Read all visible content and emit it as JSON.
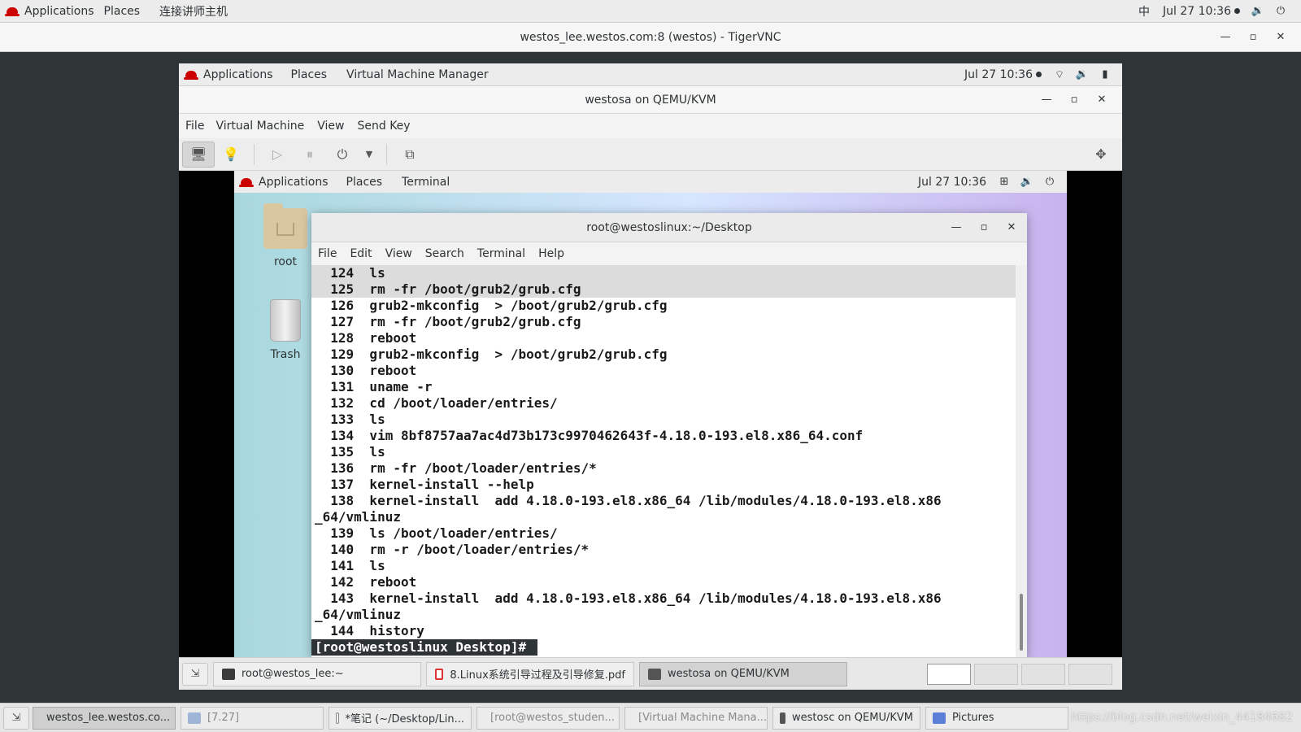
{
  "host_topbar": {
    "applications": "Applications",
    "places": "Places",
    "custom_app": "连接讲师主机",
    "ime": "中",
    "datetime": "Jul 27  10:36"
  },
  "vnc_window": {
    "title": "westos_lee.westos.com:8 (westos) - TigerVNC"
  },
  "remote_topbar": {
    "applications": "Applications",
    "places": "Places",
    "vmm": "Virtual Machine Manager",
    "datetime": "Jul 27  10:36"
  },
  "vm_window": {
    "title": "westosa on QEMU/KVM",
    "menu": [
      "File",
      "Virtual Machine",
      "View",
      "Send Key"
    ]
  },
  "guest_topbar": {
    "applications": "Applications",
    "places": "Places",
    "terminal": "Terminal",
    "datetime": "Jul 27  10:36"
  },
  "desktop_icons": {
    "home": "root",
    "trash": "Trash"
  },
  "terminal": {
    "title": "root@westoslinux:~/Desktop",
    "menu": [
      "File",
      "Edit",
      "View",
      "Search",
      "Terminal",
      "Help"
    ],
    "lines": [
      "  124  ls",
      "  125  rm -fr /boot/grub2/grub.cfg",
      "  126  grub2-mkconfig  > /boot/grub2/grub.cfg",
      "  127  rm -fr /boot/grub2/grub.cfg",
      "  128  reboot",
      "  129  grub2-mkconfig  > /boot/grub2/grub.cfg",
      "  130  reboot",
      "  131  uname -r",
      "  132  cd /boot/loader/entries/",
      "  133  ls",
      "  134  vim 8bf8757aa7ac4d73b173c9970462643f-4.18.0-193.el8.x86_64.conf",
      "  135  ls",
      "  136  rm -fr /boot/loader/entries/*",
      "  137  kernel-install --help",
      "  138  kernel-install  add 4.18.0-193.el8.x86_64 /lib/modules/4.18.0-193.el8.x86",
      "_64/vmlinuz",
      "  139  ls /boot/loader/entries/",
      "  140  rm -r /boot/loader/entries/*",
      "  141  ls",
      "  142  reboot",
      "  143  kernel-install  add 4.18.0-193.el8.x86_64 /lib/modules/4.18.0-193.el8.x86",
      "_64/vmlinuz",
      "  144  history"
    ],
    "prompt": "[root@westoslinux Desktop]# "
  },
  "remote_taskbar": {
    "tasks": [
      "root@westos_lee:~",
      "8.Linux系统引导过程及引导修复.pdf",
      "westosa on QEMU/KVM"
    ]
  },
  "host_taskbar": {
    "tasks": [
      "westos_lee.westos.co...",
      "[7.27]",
      "*笔记 (~/Desktop/Lin...",
      "[root@westos_studen...",
      "[Virtual Machine Mana...",
      "westosc on QEMU/KVM",
      "Pictures"
    ],
    "watermark": "https://blog.csdn.net/weixin_44184682"
  }
}
